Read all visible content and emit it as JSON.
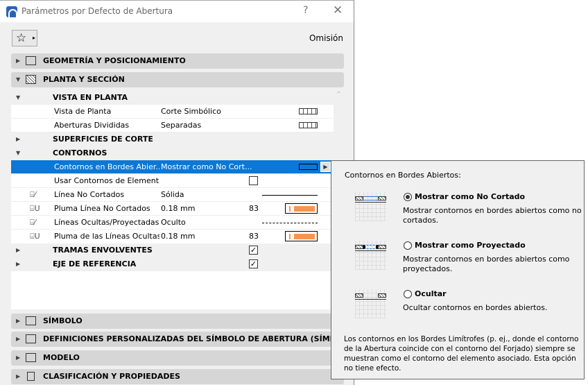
{
  "window": {
    "title": "Parámetros por Defecto de Abertura",
    "help": "?",
    "close": "✕"
  },
  "favorites": {
    "icon": "star-icon",
    "glyph": "☆",
    "arrow": "▸"
  },
  "preset": "Omisión",
  "panels": [
    {
      "label": "GEOMETRÍA Y POSICIONAMIENTO",
      "expanded": false
    },
    {
      "label": "PLANTA Y SECCIÓN",
      "expanded": true
    },
    {
      "label": "SÍMBOLO",
      "expanded": false
    },
    {
      "label": "DEFINICIONES PERSONALIZADAS DEL SÍMBOLO DE ABERTURA (SÍMBOLO DE CO",
      "expanded": false
    },
    {
      "label": "MODELO",
      "expanded": false
    },
    {
      "label": "CLASIFICACIÓN Y PROPIEDADES",
      "expanded": false
    }
  ],
  "rows": {
    "vista": "VISTA EN PLANTA",
    "vista_planta": {
      "name": "Vista de Planta",
      "value": "Corte Simbólico"
    },
    "aberturas": {
      "name": "Aberturas Divididas",
      "value": "Separadas"
    },
    "superficies": "SUPERFICIES DE CORTE",
    "contornos": "CONTORNOS",
    "bordes": {
      "name": "Contornos en Bordes Abier...",
      "value": "Mostrar como No Cort..."
    },
    "usar": {
      "name": "Usar Contornos de Element...",
      "checked": false
    },
    "linea": {
      "name": "Línea No Cortados",
      "value": "Sólida"
    },
    "pluma": {
      "name": "Pluma Línea No Cortados",
      "value": "0.18 mm",
      "pen": "83"
    },
    "ocultas": {
      "name": "Líneas Ocultas/Proyectadas",
      "value": "Oculto"
    },
    "pluma_ocultas": {
      "name": "Pluma de las Líneas Ocultas...",
      "value": "0.18 mm",
      "pen": "83"
    },
    "tramas": {
      "name": "TRAMAS ENVOLVENTES",
      "checked": true
    },
    "eje": {
      "name": "EJE DE REFERENCIA",
      "checked": true
    }
  },
  "pen_color": "#f7954f",
  "popup": {
    "heading": "Contornos en Bordes Abiertos:",
    "options": [
      {
        "label": "Mostrar como No Cortado",
        "desc": "Mostrar contornos en bordes abiertos como no cortados.",
        "selected": true
      },
      {
        "label": "Mostrar como Proyectado",
        "desc": "Mostrar contornos en bordes abiertos como proyectados.",
        "selected": false
      },
      {
        "label": "Ocultar",
        "desc": "Ocultar contornos en bordes abiertos.",
        "selected": false
      }
    ],
    "note": "Los contornos en los Bordes Limítrofes (p. ej., donde el contorno de la Abertura coincide con el contorno del Forjado) siempre se muestran como el contorno del elemento asociado. Esta opción no tiene efecto."
  }
}
